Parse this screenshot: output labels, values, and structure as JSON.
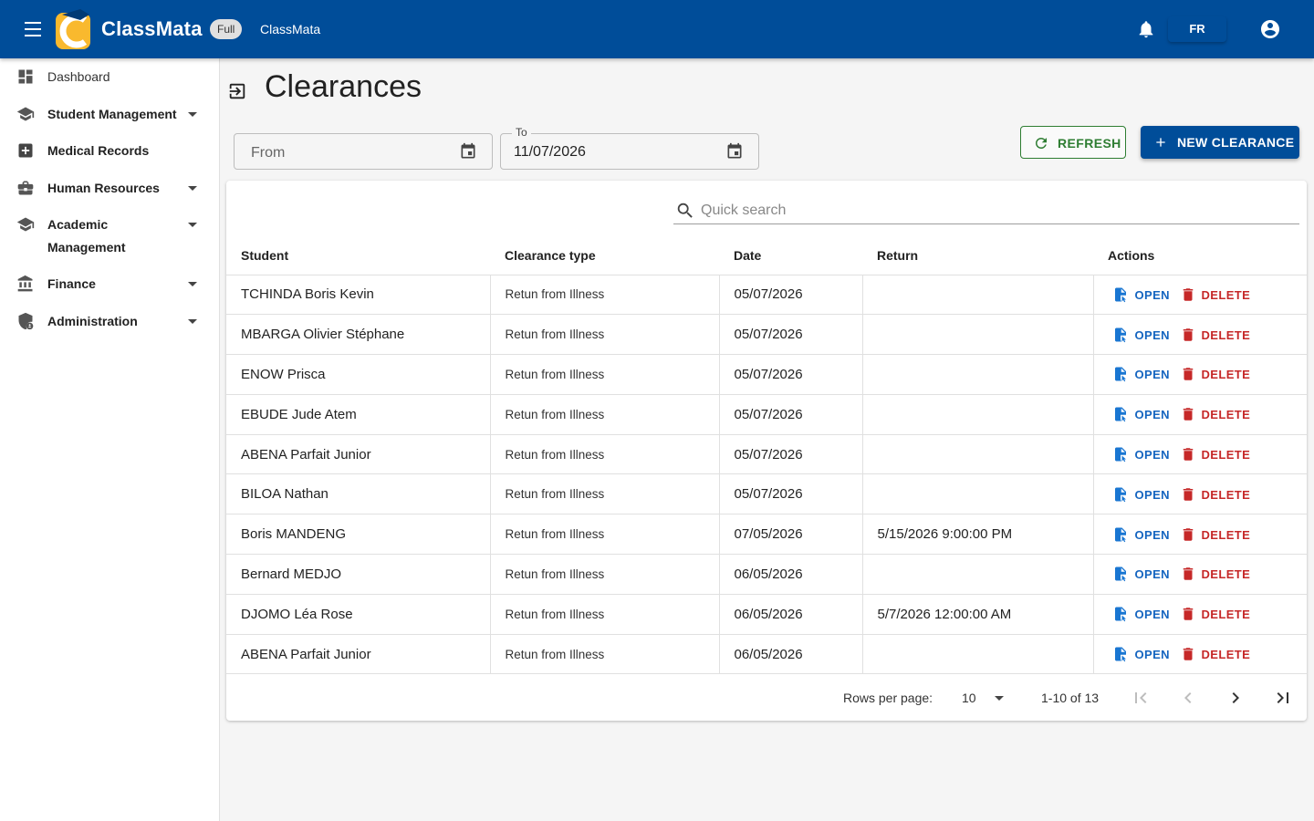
{
  "header": {
    "brand": "ClassMata",
    "badge": "Full",
    "app_name": "ClassMata",
    "language": "FR",
    "logo_letters": "CM",
    "colors": {
      "primary": "#004d99",
      "logo_yellow": "#f9b92e"
    }
  },
  "sidebar": {
    "items": [
      {
        "label": "Dashboard",
        "icon": "dashboard-icon"
      },
      {
        "label": "Student Management",
        "icon": "school-icon",
        "expandable": true
      },
      {
        "label": "Medical Records",
        "icon": "medical-cross-icon"
      },
      {
        "label": "Human Resources",
        "icon": "briefcase-icon",
        "expandable": true
      },
      {
        "label": "Academic",
        "label2": "Management",
        "icon": "school-icon",
        "expandable": true
      },
      {
        "label": "Finance",
        "icon": "bank-icon",
        "expandable": true
      },
      {
        "label": "Administration",
        "icon": "admin-shield-icon",
        "expandable": true
      }
    ]
  },
  "page": {
    "title": "Clearances",
    "icon": "logout-icon"
  },
  "filters": {
    "from_placeholder": "From",
    "to_label": "To",
    "to_value": "11/07/2026"
  },
  "buttons": {
    "refresh": "REFRESH",
    "new_clearance": "NEW CLEARANCE"
  },
  "search": {
    "placeholder": "Quick search"
  },
  "table": {
    "columns": [
      "Student",
      "Clearance type",
      "Date",
      "Return",
      "Actions"
    ],
    "open_label": "OPEN",
    "delete_label": "DELETE",
    "rows": [
      {
        "student": "TCHINDA Boris Kevin",
        "type": "Retun from Illness",
        "date": "05/07/2026",
        "return": ""
      },
      {
        "student": "MBARGA Olivier Stéphane",
        "type": "Retun from Illness",
        "date": "05/07/2026",
        "return": ""
      },
      {
        "student": "ENOW Prisca",
        "type": "Retun from Illness",
        "date": "05/07/2026",
        "return": ""
      },
      {
        "student": "EBUDE Jude Atem",
        "type": "Retun from Illness",
        "date": "05/07/2026",
        "return": ""
      },
      {
        "student": "ABENA Parfait Junior",
        "type": "Retun from Illness",
        "date": "05/07/2026",
        "return": ""
      },
      {
        "student": "BILOA Nathan",
        "type": "Retun from Illness",
        "date": "05/07/2026",
        "return": ""
      },
      {
        "student": "Boris MANDENG",
        "type": "Retun from Illness",
        "date": "07/05/2026",
        "return": "5/15/2026 9:00:00 PM"
      },
      {
        "student": "Bernard MEDJO",
        "type": "Retun from Illness",
        "date": "06/05/2026",
        "return": ""
      },
      {
        "student": "DJOMO Léa Rose",
        "type": "Retun from Illness",
        "date": "06/05/2026",
        "return": "5/7/2026 12:00:00 AM"
      },
      {
        "student": "ABENA Parfait Junior",
        "type": "Retun from Illness",
        "date": "06/05/2026",
        "return": ""
      }
    ]
  },
  "pagination": {
    "rows_per_page_label": "Rows per page:",
    "rows_per_page": "10",
    "range": "1-10 of 13"
  }
}
